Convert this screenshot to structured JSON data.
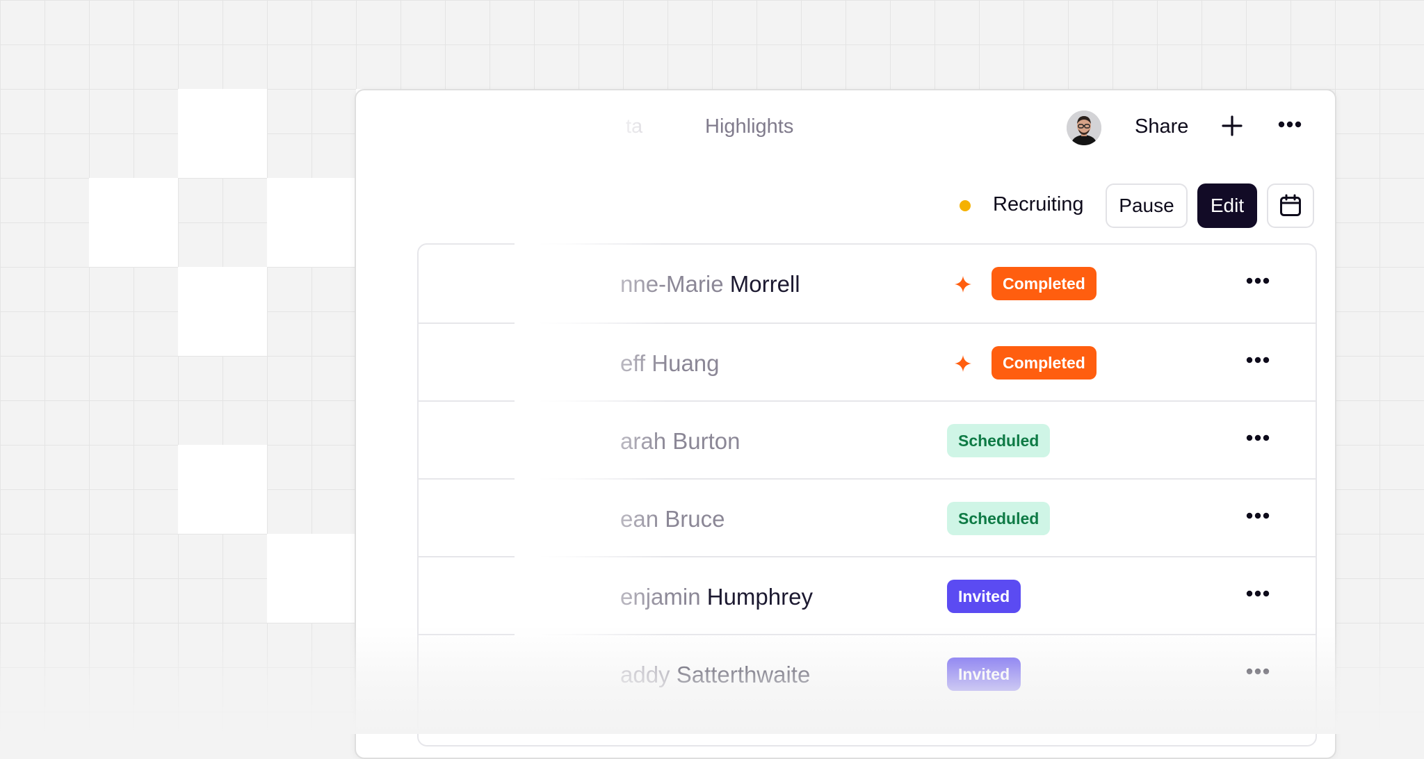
{
  "tabs": [
    "ta",
    "Highlights"
  ],
  "header": {
    "share_label": "Share",
    "plus_icon": "plus-icon",
    "more_icon": "more-horizontal-icon"
  },
  "status": {
    "label": "Recruiting",
    "dot_color": "#F5B100"
  },
  "toolbar": {
    "pause_label": "Pause",
    "edit_label": "Edit",
    "calendar_icon": "calendar-icon"
  },
  "participants": [
    {
      "name_faded": "nne-Marie",
      "name_rest": " Morrell",
      "status": "Completed",
      "sparkle": true
    },
    {
      "name_faded": "eff Huang",
      "name_rest": "",
      "status": "Completed",
      "sparkle": true
    },
    {
      "name_faded": "arah Burton",
      "name_rest": "",
      "status": "Scheduled",
      "sparkle": false
    },
    {
      "name_faded": "ean Bruce",
      "name_rest": "",
      "status": "Scheduled",
      "sparkle": false
    },
    {
      "name_faded": "enjamin",
      "name_rest": " Humphrey",
      "status": "Invited",
      "sparkle": false
    },
    {
      "name_faded": "addy",
      "name_rest": " Satterthwaite",
      "status": "Invited",
      "sparkle": false
    }
  ],
  "status_colors": {
    "Completed": {
      "bg": "#FF5E0F",
      "fg": "#FFFFFF"
    },
    "Scheduled": {
      "bg": "#CFF5E6",
      "fg": "#0E7A45"
    },
    "Invited": {
      "bg": "#5B4BF2",
      "fg": "#FFFFFF"
    }
  },
  "sparkle_color": "#FF5E0F"
}
